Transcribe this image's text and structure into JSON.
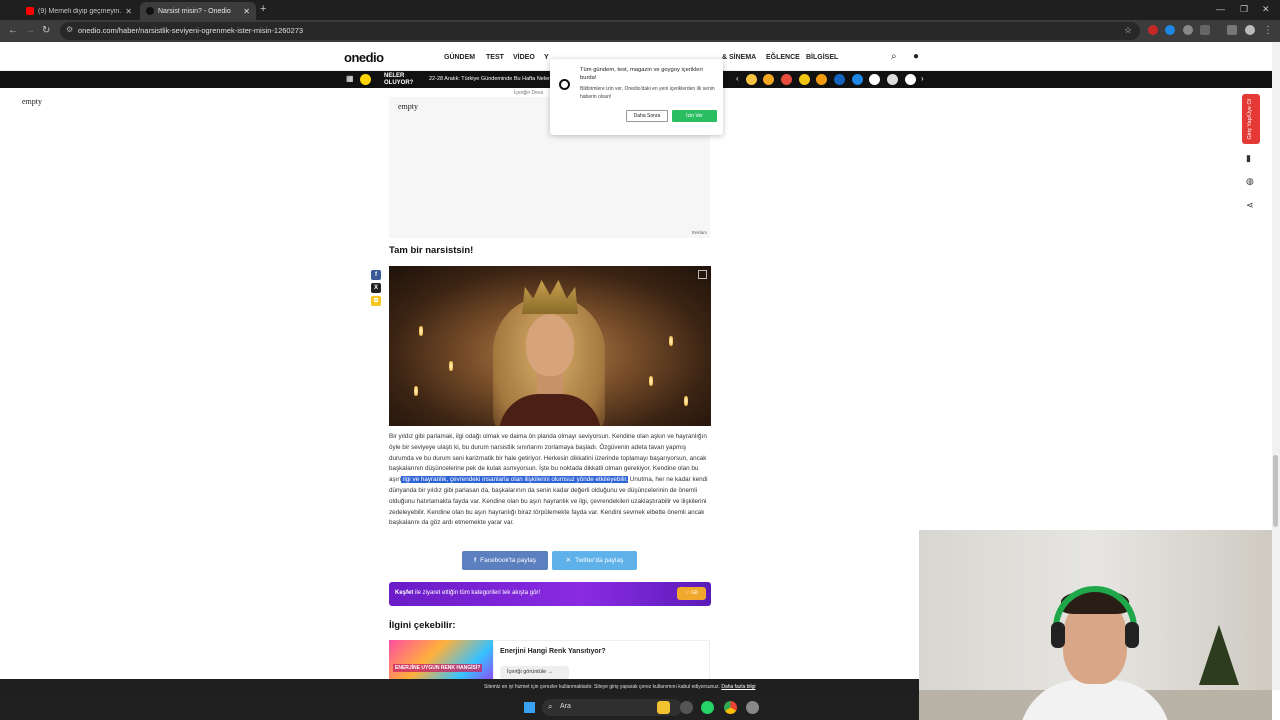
{
  "browser": {
    "tabs": [
      {
        "title": "(9) Memeli diyip geçmeyin... - Y"
      },
      {
        "title": "Narsist misin? - Onedio"
      }
    ],
    "url": "onedio.com/haber/narsistlik-seviyeni-ogrenmek-ister-misin-1260273",
    "new_tab": "+"
  },
  "site": {
    "logo": "onedio",
    "nav": [
      "GÜNDEM",
      "TEST",
      "VİDEO",
      "Y",
      "& SİNEMA",
      "EĞLENCE",
      "BİLGİSEL"
    ],
    "neler_line1": "NELER",
    "neler_line2": "OLUYOR?",
    "headline": "22-28 Aralık: Türkiye Gündeminde Bu Hafta Neler Y",
    "content_continues": "İçeriğin Deva"
  },
  "left_empty": "empty",
  "ad": {
    "text": "empty",
    "label": "Reklam"
  },
  "notification": {
    "title": "Tüm gündem, test, magazin ve goygoy içerikleri burda!",
    "body": "Bildirimlere izin ver, Onedio'daki en yeni içeriklerden ilk senin haberin olsun!",
    "later": "Daha Sonra",
    "allow": "İzin Ver"
  },
  "article": {
    "heading": "Tam bir narsistsin!",
    "para_before": "Bir yıldız gibi parlamak, ilgi odağı olmak ve daima ön planda olmayı seviyorsun. Kendine olan aşkın ve hayranlığın öyle bir seviyeye ulaştı ki, bu durum narsistlik sınırlarını zorlamaya başladı. Özgüvenin adeta tavan yapmış durumda ve bu durum seni karizmatik bir hale getiriyor. Herkesin dikkatini üzerinde toplamayı başarıyorsun, ancak başkalarının düşüncelerine pek de kulak asmıyorsun. İşte bu noktada dikkatli olman gerekiyor. Kendine olan bu aşırı",
    "para_selected": " ilgi ve hayranlık, çevrendeki insanlarla olan ilişkilerini olumsuz yönde etkileyebilir.",
    "para_after": " Unutma, her ne kadar kendi dünyanda bir yıldız gibi parlasan da, başkalarının da senin kadar değerli olduğunu ve düşüncelerinin de önemli olduğunu hatırlamakta fayda var. Kendine olan bu aşırı hayranlık ve ilgi, çevrendekileri uzaklaştırabilir ve ilişkilerini zedeleyebilir. Kendine olan bu aşırı hayranlığı biraz törpülemekte fayda var. Kendini sevmek elbette önemli ancak başkalarını da göz ardı etmemekte yarar var.",
    "share_facebook": "Facebook'ta paylaş",
    "share_twitter": "Twitter'da paylaş"
  },
  "kesfet": {
    "bold": "Keşfet",
    "text": " ile ziyaret ettiğin tüm kategorileri tek akışta gör!",
    "button": "Git"
  },
  "recommend": {
    "heading": "İlgini çekebilir:",
    "image_text": "ENERJİNE UYGUN RENK HANGİSİ?",
    "title": "Enerjini Hangi Renk Yansıtıyor?",
    "button": "İçeriği görüntüle"
  },
  "cookie": {
    "text": "Sitemiz en iyi hizmet için çerezler kullanmaktadır. Siteye giriş yaparak çerez kullanımını kabul ediyorsunuz.",
    "link": "Daha fazla bilgi"
  },
  "side": {
    "login": "Giriş Yap/Üye Ol"
  },
  "taskbar": {
    "search": "Ara"
  },
  "colors": {
    "accent_purple": "#7b22d6",
    "selection": "#2f64d6",
    "login_red": "#e53935"
  }
}
